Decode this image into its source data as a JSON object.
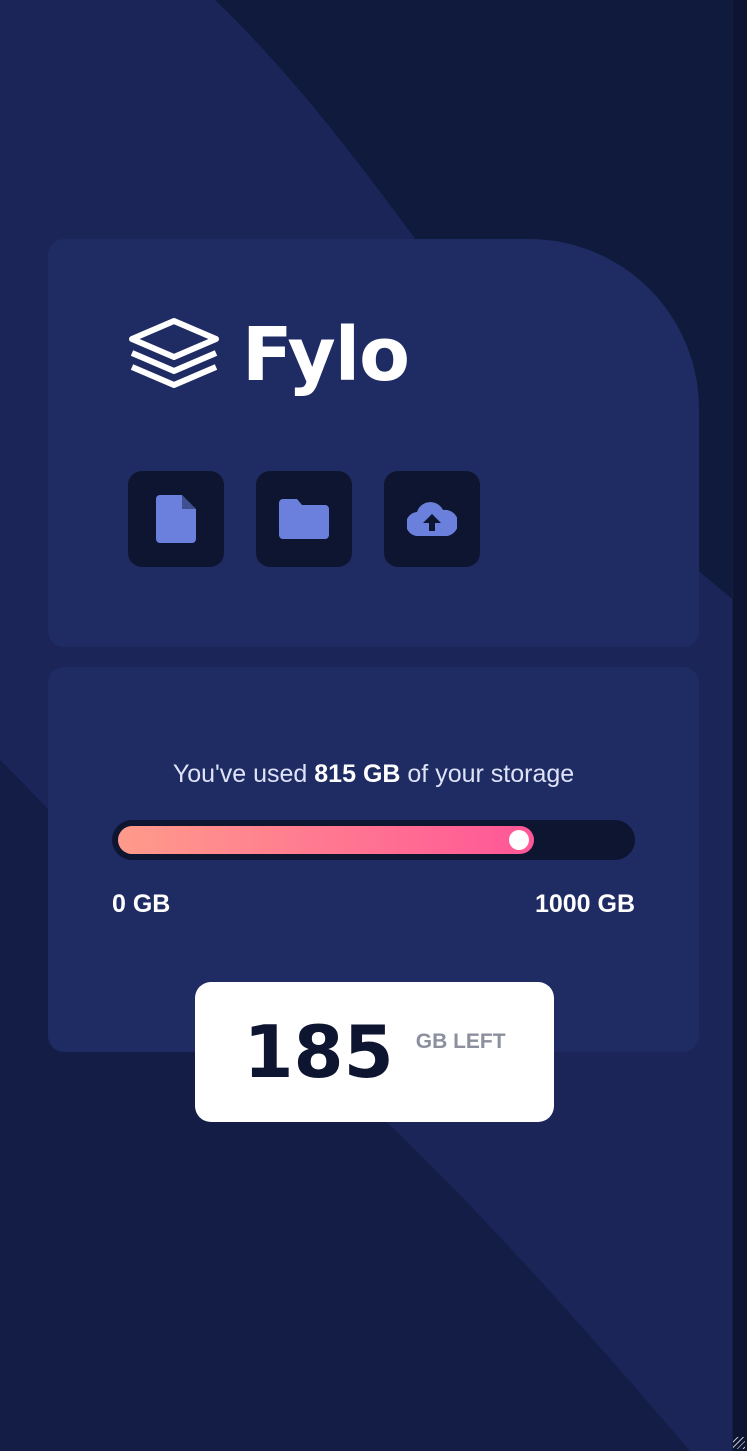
{
  "brand": {
    "name": "Fylo",
    "logo_icon": "stacked-layers-icon"
  },
  "actions": [
    {
      "icon": "document-icon",
      "color": "#6b80dc"
    },
    {
      "icon": "folder-icon",
      "color": "#6b80dc"
    },
    {
      "icon": "upload-cloud-icon",
      "color": "#6b80dc"
    }
  ],
  "storage": {
    "prefix": "You've used ",
    "used": "815 GB",
    "suffix": " of your storage",
    "min_label": "0 GB",
    "max_label": "1000 GB",
    "used_fraction": 0.815,
    "remaining_value": "185",
    "remaining_unit": "GB LEFT"
  },
  "colors": {
    "background": "#101a3c",
    "card": "#1f2b63",
    "bar_start": "#ff9b8a",
    "bar_end": "#ff5697",
    "icon": "#6b80dc"
  }
}
